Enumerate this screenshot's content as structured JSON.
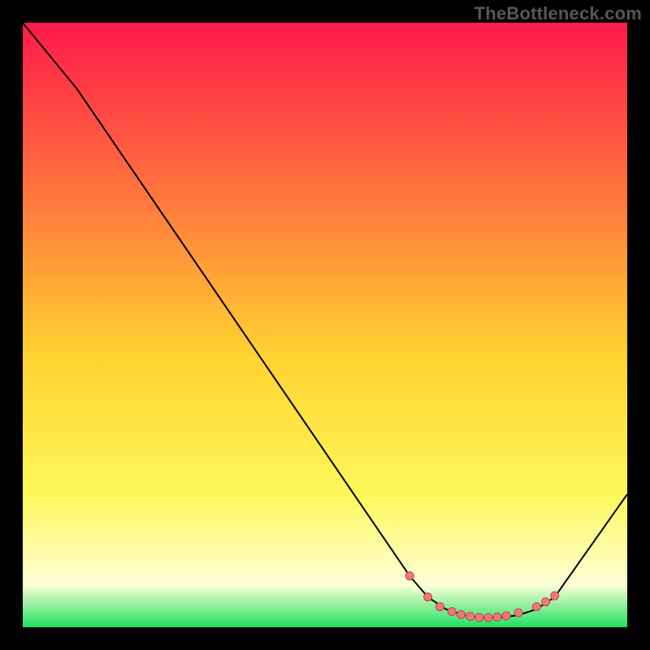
{
  "watermark": "TheBottleneck.com",
  "colors": {
    "gradient_top": "#ff1a4b",
    "gradient_mid_upper": "#ff7a3c",
    "gradient_mid": "#ffd230",
    "gradient_lower": "#fff85a",
    "gradient_pale": "#fcffd8",
    "gradient_green": "#20e060",
    "line": "#000000",
    "marker_fill": "#f07878",
    "marker_stroke": "#c04848",
    "frame": "#000000"
  },
  "chart_data": {
    "type": "line",
    "title": "",
    "xlabel": "",
    "ylabel": "",
    "xlim": [
      0,
      100
    ],
    "ylim": [
      0,
      100
    ],
    "series": [
      {
        "name": "curve",
        "x": [
          0,
          9,
          64,
          67,
          70,
          73,
          76,
          79,
          82,
          85,
          88,
          100
        ],
        "y": [
          100,
          89,
          8.5,
          5,
          3,
          2,
          1.6,
          1.6,
          2,
          3,
          5,
          22
        ]
      }
    ],
    "markers": {
      "name": "highlight-points",
      "x": [
        64,
        67,
        69,
        71,
        72.5,
        74,
        75.5,
        77,
        78.5,
        80,
        82,
        85,
        86.5,
        88
      ],
      "y": [
        8.5,
        5,
        3.4,
        2.6,
        2.1,
        1.8,
        1.6,
        1.6,
        1.7,
        1.9,
        2.4,
        3.4,
        4.2,
        5.2
      ]
    }
  }
}
